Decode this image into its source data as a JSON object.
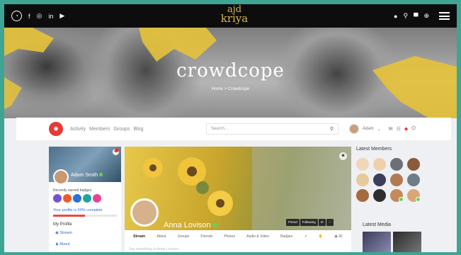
{
  "topbar": {
    "social_icons": [
      "brand-circle-icon",
      "facebook-icon",
      "instagram-icon",
      "linkedin-icon",
      "youtube-icon"
    ],
    "brand_top": "ajd",
    "brand_bottom": "kriya",
    "right_icons": [
      "user-icon",
      "search-icon",
      "cart-icon",
      "globe-icon",
      "menu-icon"
    ]
  },
  "hero": {
    "title": "crowdcope",
    "breadcrumb": "Home > Crowdcope"
  },
  "navbar": {
    "links": [
      "Activity",
      "Members",
      "Groups",
      "Blog"
    ],
    "search_placeholder": "Search...",
    "user_name": "Adam"
  },
  "sidebar_profile": {
    "name": "Adam Smith",
    "badges_label": "Recently earned badges",
    "complete_text": "Your profile is 50% complete",
    "progress": 0.5,
    "my_profile_label": "My Profile",
    "menu": [
      "Stream",
      "About"
    ]
  },
  "profile": {
    "name": "Anna Lovison",
    "buttons": [
      "Friend",
      "Following"
    ],
    "tabs": [
      "Stream",
      "About",
      "Groups",
      "Friends",
      "Photos",
      "Audio & Video",
      "Badges"
    ],
    "tab_count": "42",
    "composer_placeholder": "Say something to Anna Lovison..."
  },
  "right": {
    "latest_members_title": "Latest Members",
    "latest_media_title": "Latest Media"
  },
  "colors": {
    "accent_red": "#e53935",
    "link_blue": "#2d6fd6",
    "online_green": "#6ad34e",
    "brand_gold": "#d9b54a"
  }
}
